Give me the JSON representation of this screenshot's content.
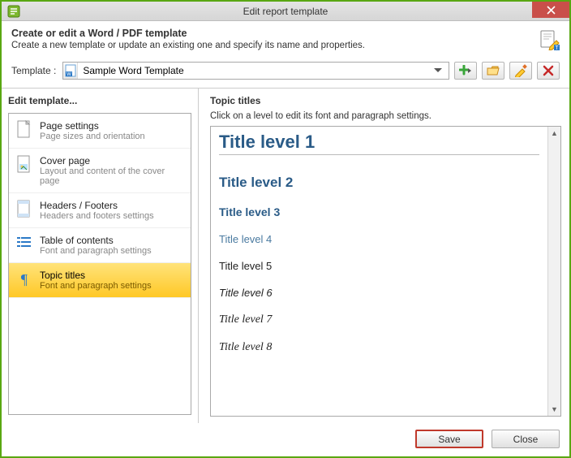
{
  "window": {
    "title": "Edit report template"
  },
  "header": {
    "title": "Create or edit a Word / PDF template",
    "desc": "Create a new template or update an existing one and specify its name and properties."
  },
  "toolbar": {
    "label": "Template :",
    "selected": "Sample Word Template"
  },
  "sidepane": {
    "title": "Edit template...",
    "items": [
      {
        "title": "Page settings",
        "desc": "Page sizes and orientation"
      },
      {
        "title": "Cover page",
        "desc": "Layout and content of the cover page"
      },
      {
        "title": "Headers / Footers",
        "desc": "Headers and footers settings"
      },
      {
        "title": "Table of contents",
        "desc": "Font and paragraph settings"
      },
      {
        "title": "Topic titles",
        "desc": "Font and paragraph settings"
      }
    ]
  },
  "content": {
    "title": "Topic titles",
    "hint": "Click on a level to edit its font and paragraph settings.",
    "levels": {
      "l1": "Title level 1",
      "l2": "Title level 2",
      "l3": "Title level 3",
      "l4": "Title level 4",
      "l5": "Title level 5",
      "l6": "Title level 6",
      "l7": "Title level 7",
      "l8": "Title level 8"
    }
  },
  "footer": {
    "save": "Save",
    "close": "Close"
  }
}
